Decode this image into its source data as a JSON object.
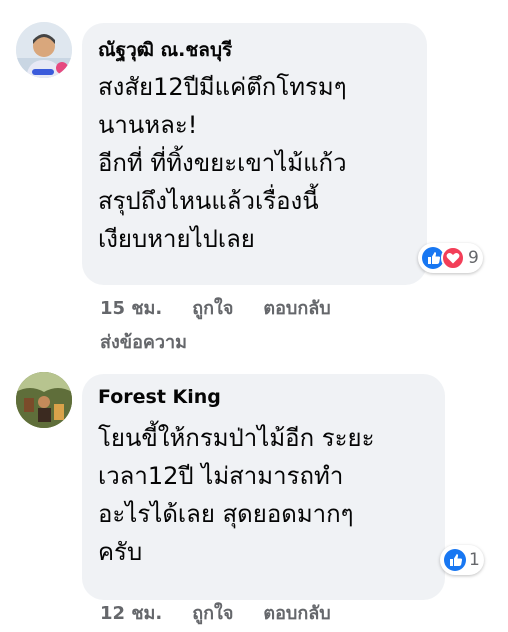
{
  "comments": [
    {
      "author": "ณัฐวุฒิ ณ.ชลบุรี",
      "lines": [
        "สงสัย12ปีมีแค่ตึกโทรมๆ",
        "นานหละ!",
        "อีกที่ ที่ทิ้งขยะเขาไม้แก้ว",
        "สรุปถึงไหนแล้วเรื่องนี้",
        "เงียบหายไปเลย"
      ],
      "reaction_icons": [
        "like-icon",
        "love-icon"
      ],
      "reaction_count": "9",
      "time": "15 ชม.",
      "like_label": "ถูกใจ",
      "reply_label": "ตอบกลับ",
      "message_label": "ส่งข้อความ"
    },
    {
      "author": "Forest King",
      "lines": [
        "โยนขี้ให้กรมป่าไม้อีก ระยะ",
        "เวลา12ปี ไม่สามารถทำ",
        "อะไรได้เลย สุดยอดมากๆ",
        "ครับ"
      ],
      "reaction_icons": [
        "like-icon"
      ],
      "reaction_count": "1",
      "time": "12 ชม.",
      "like_label": "ถูกใจ",
      "reply_label": "ตอบกลับ"
    }
  ],
  "colors": {
    "bubble": "#f0f2f5",
    "meta_text": "#65676b",
    "like_blue": "#1877f2",
    "love_red": "#f33e58"
  }
}
